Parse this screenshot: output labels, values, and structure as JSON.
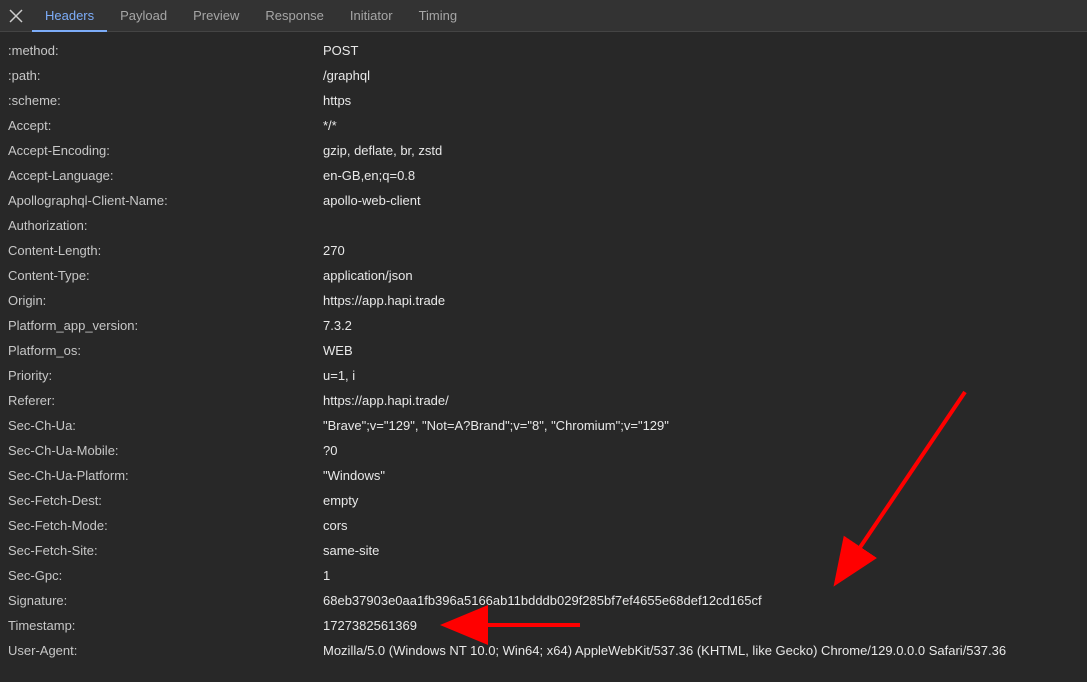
{
  "tabs": {
    "headers": "Headers",
    "payload": "Payload",
    "preview": "Preview",
    "response": "Response",
    "initiator": "Initiator",
    "timing": "Timing"
  },
  "headers": [
    {
      "key": ":method:",
      "value": "POST"
    },
    {
      "key": ":path:",
      "value": "/graphql"
    },
    {
      "key": ":scheme:",
      "value": "https"
    },
    {
      "key": "Accept:",
      "value": "*/*"
    },
    {
      "key": "Accept-Encoding:",
      "value": "gzip, deflate, br, zstd"
    },
    {
      "key": "Accept-Language:",
      "value": "en-GB,en;q=0.8"
    },
    {
      "key": "Apollographql-Client-Name:",
      "value": "apollo-web-client"
    },
    {
      "key": "Authorization:",
      "value": ""
    },
    {
      "key": "Content-Length:",
      "value": "270"
    },
    {
      "key": "Content-Type:",
      "value": "application/json"
    },
    {
      "key": "Origin:",
      "value": "https://app.hapi.trade"
    },
    {
      "key": "Platform_app_version:",
      "value": "7.3.2"
    },
    {
      "key": "Platform_os:",
      "value": "WEB"
    },
    {
      "key": "Priority:",
      "value": "u=1, i"
    },
    {
      "key": "Referer:",
      "value": "https://app.hapi.trade/"
    },
    {
      "key": "Sec-Ch-Ua:",
      "value": "\"Brave\";v=\"129\", \"Not=A?Brand\";v=\"8\", \"Chromium\";v=\"129\""
    },
    {
      "key": "Sec-Ch-Ua-Mobile:",
      "value": "?0"
    },
    {
      "key": "Sec-Ch-Ua-Platform:",
      "value": "\"Windows\""
    },
    {
      "key": "Sec-Fetch-Dest:",
      "value": "empty"
    },
    {
      "key": "Sec-Fetch-Mode:",
      "value": "cors"
    },
    {
      "key": "Sec-Fetch-Site:",
      "value": "same-site"
    },
    {
      "key": "Sec-Gpc:",
      "value": "1"
    },
    {
      "key": "Signature:",
      "value": "68eb37903e0aa1fb396a5166ab11bdddb029f285bf7ef4655e68def12cd165cf"
    },
    {
      "key": "Timestamp:",
      "value": "1727382561369"
    },
    {
      "key": "User-Agent:",
      "value": "Mozilla/5.0 (Windows NT 10.0; Win64; x64) AppleWebKit/537.36 (KHTML, like Gecko) Chrome/129.0.0.0 Safari/537.36"
    }
  ]
}
